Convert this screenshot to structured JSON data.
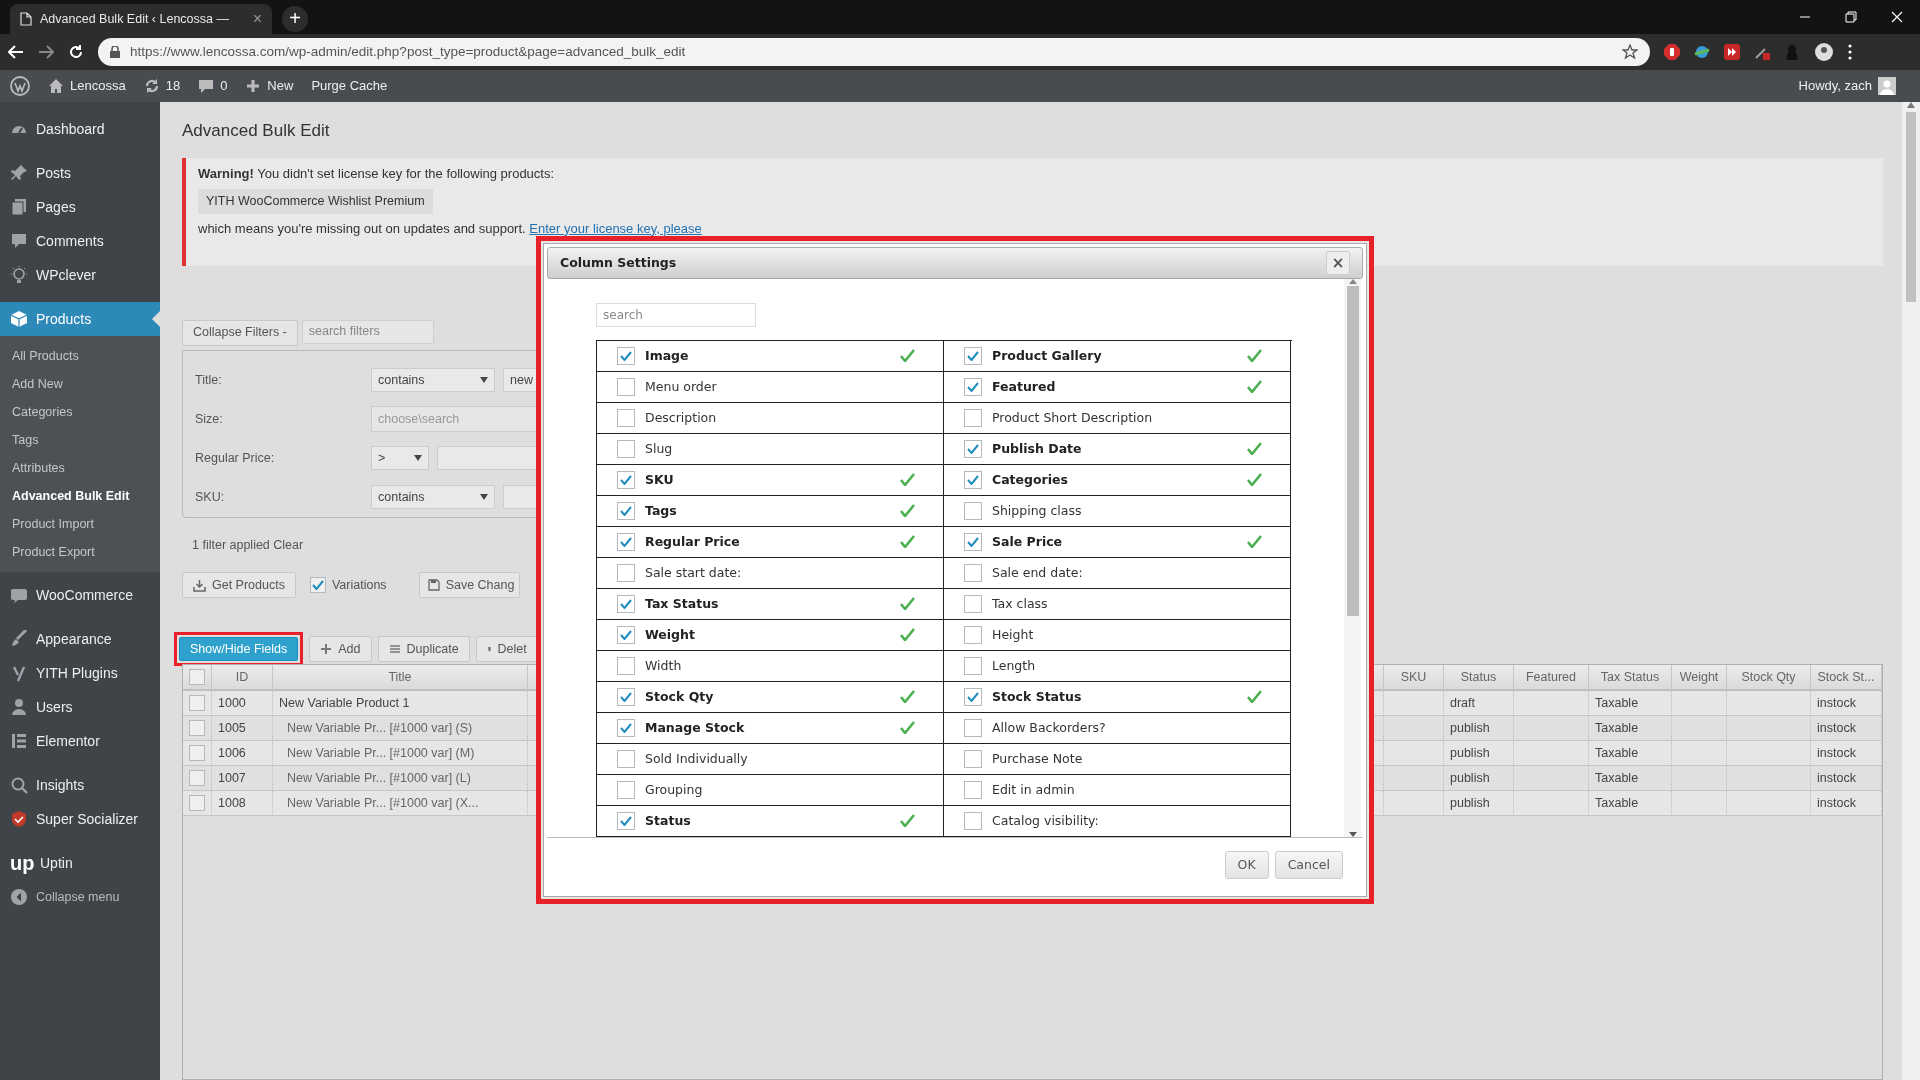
{
  "browser": {
    "tab_title": "Advanced Bulk Edit ‹ Lencossa —",
    "tab_close": "×",
    "new_tab": "+",
    "url": "https://www.lencossa.com/wp-admin/edit.php?post_type=product&page=advanced_bulk_edit"
  },
  "admin_bar": {
    "site": "Lencossa",
    "updates": "18",
    "comments": "0",
    "new": "New",
    "purge": "Purge Cache",
    "howdy": "Howdy, zach"
  },
  "sidebar": {
    "items": [
      {
        "label": "Dashboard",
        "kind": "menu",
        "selected": false
      },
      {
        "label": "Posts",
        "kind": "menu",
        "selected": false
      },
      {
        "label": "Pages",
        "kind": "menu",
        "selected": false
      },
      {
        "label": "Comments",
        "kind": "menu",
        "selected": false
      },
      {
        "label": "WPclever",
        "kind": "menu",
        "selected": false
      },
      {
        "label": "Products",
        "kind": "menu",
        "selected": true
      },
      {
        "label": "All Products",
        "kind": "sub",
        "selected": false
      },
      {
        "label": "Add New",
        "kind": "sub",
        "selected": false
      },
      {
        "label": "Categories",
        "kind": "sub",
        "selected": false
      },
      {
        "label": "Tags",
        "kind": "sub",
        "selected": false
      },
      {
        "label": "Attributes",
        "kind": "sub",
        "selected": false
      },
      {
        "label": "Advanced Bulk Edit",
        "kind": "sub",
        "selected": true
      },
      {
        "label": "Product Import",
        "kind": "sub",
        "selected": false
      },
      {
        "label": "Product Export",
        "kind": "sub",
        "selected": false
      },
      {
        "label": "WooCommerce",
        "kind": "menu",
        "selected": false
      },
      {
        "label": "Appearance",
        "kind": "menu",
        "selected": false
      },
      {
        "label": "YITH Plugins",
        "kind": "menu",
        "selected": false
      },
      {
        "label": "Users",
        "kind": "menu",
        "selected": false
      },
      {
        "label": "Elementor",
        "kind": "menu",
        "selected": false
      },
      {
        "label": "Insights",
        "kind": "menu",
        "selected": false
      },
      {
        "label": "Super Socializer",
        "kind": "menu",
        "selected": false
      },
      {
        "label": "Uptin",
        "kind": "menu",
        "selected": false,
        "logo": "up"
      },
      {
        "label": "Collapse menu",
        "kind": "collapse",
        "selected": false
      }
    ]
  },
  "page": {
    "title": "Advanced Bulk Edit",
    "notice": {
      "message": "**Warning!** You didn't set license key for the following products:",
      "product": "YITH WooCommerce Wishlist Premium",
      "footer": "which means you're missing out on updates and support.",
      "link": "Enter your license key, please"
    },
    "filters": {
      "collapse": "Collapse Filters -",
      "search_placeholder": "search filters",
      "rows": [
        {
          "label": "Title:",
          "kind": "select",
          "select": "contains",
          "value": "new"
        },
        {
          "label": "Size:",
          "kind": "search",
          "placeholder": "choose\\search"
        },
        {
          "label": "Regular Price:",
          "kind": "select",
          "select": ">"
        },
        {
          "label": "SKU:",
          "kind": "select",
          "select": "contains"
        }
      ],
      "applied": "1 filter applied",
      "clear": "Clear"
    },
    "actions": {
      "get_products": "Get Products",
      "variations": {
        "label": "Variations",
        "checked": true
      },
      "save": "Save Chang"
    },
    "toolbar": {
      "show_hide": "Show/Hide Fields",
      "add": "Add",
      "duplicate": "Duplicate",
      "delete": "Delet"
    },
    "table": {
      "header_checked": false,
      "columns": [
        "ID",
        "Title",
        "SKU",
        "Status",
        "Featured",
        "Tax Status",
        "Weight",
        "Stock Qty",
        "Stock St..."
      ],
      "rows": [
        {
          "checked": false,
          "kind": "parent",
          "id": "1000",
          "title": "New Variable Product 1",
          "status": "draft",
          "tax_status": "Taxable",
          "stock_status": "instock"
        },
        {
          "checked": false,
          "kind": "variation",
          "id": "1005",
          "title": "New Variable Pr... [#1000 var] (S)",
          "status": "publish",
          "tax_status": "Taxable",
          "stock_status": "instock"
        },
        {
          "checked": false,
          "kind": "variation",
          "id": "1006",
          "title": "New Variable Pr... [#1000 var] (M)",
          "status": "publish",
          "tax_status": "Taxable",
          "stock_status": "instock"
        },
        {
          "checked": false,
          "kind": "variation",
          "id": "1007",
          "title": "New Variable Pr... [#1000 var] (L)",
          "status": "publish",
          "tax_status": "Taxable",
          "stock_status": "instock"
        },
        {
          "checked": false,
          "kind": "variation",
          "id": "1008",
          "title": "New Variable Pr... [#1000 var] (X...",
          "status": "publish",
          "tax_status": "Taxable",
          "stock_status": "instock"
        }
      ]
    }
  },
  "dialog": {
    "title": "Column Settings",
    "close": "×",
    "search_placeholder": "search",
    "fields": [
      {
        "label": "Image",
        "checked": true
      },
      {
        "label": "Product Gallery",
        "checked": true
      },
      {
        "label": "Menu order",
        "checked": false
      },
      {
        "label": "Featured",
        "checked": true
      },
      {
        "label": "Description",
        "checked": false
      },
      {
        "label": "Product Short Description",
        "checked": false
      },
      {
        "label": "Slug",
        "checked": false
      },
      {
        "label": "Publish Date",
        "checked": true
      },
      {
        "label": "SKU",
        "checked": true
      },
      {
        "label": "Categories",
        "checked": true
      },
      {
        "label": "Tags",
        "checked": true
      },
      {
        "label": "Shipping class",
        "checked": false
      },
      {
        "label": "Regular Price",
        "checked": true
      },
      {
        "label": "Sale Price",
        "checked": true
      },
      {
        "label": "Sale start date:",
        "checked": false
      },
      {
        "label": "Sale end date:",
        "checked": false
      },
      {
        "label": "Tax Status",
        "checked": true
      },
      {
        "label": "Tax class",
        "checked": false
      },
      {
        "label": "Weight",
        "checked": true
      },
      {
        "label": "Height",
        "checked": false
      },
      {
        "label": "Width",
        "checked": false
      },
      {
        "label": "Length",
        "checked": false
      },
      {
        "label": "Stock Qty",
        "checked": true
      },
      {
        "label": "Stock Status",
        "checked": true
      },
      {
        "label": "Manage Stock",
        "checked": true
      },
      {
        "label": "Allow Backorders?",
        "checked": false
      },
      {
        "label": "Sold Individually",
        "checked": false
      },
      {
        "label": "Purchase Note",
        "checked": false
      },
      {
        "label": "Grouping",
        "checked": false
      },
      {
        "label": "Edit in admin",
        "checked": false
      },
      {
        "label": "Status",
        "checked": true
      },
      {
        "label": "Catalog visibility:",
        "checked": false
      }
    ],
    "buttons": [
      "OK",
      "Cancel"
    ]
  }
}
